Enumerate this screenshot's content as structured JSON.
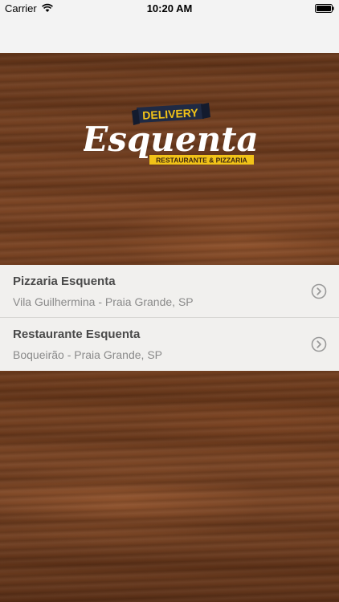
{
  "status_bar": {
    "carrier": "Carrier",
    "time": "10:20 AM",
    "wifi_icon": "wifi-icon",
    "battery_icon": "battery-icon"
  },
  "logo": {
    "banner_text": "DELIVERY",
    "brand": "Esquenta",
    "tagline": "RESTAURANTE & PIZZARIA",
    "banner_color": "#1f2a44",
    "tagline_color": "#f2c318"
  },
  "locations": [
    {
      "name": "Pizzaria Esquenta",
      "address": "Vila Guilhermina - Praia Grande, SP",
      "icon": "chevron-right-circle-icon"
    },
    {
      "name": "Restaurante Esquenta",
      "address": "Boqueirão - Praia Grande, SP",
      "icon": "chevron-right-circle-icon"
    }
  ]
}
